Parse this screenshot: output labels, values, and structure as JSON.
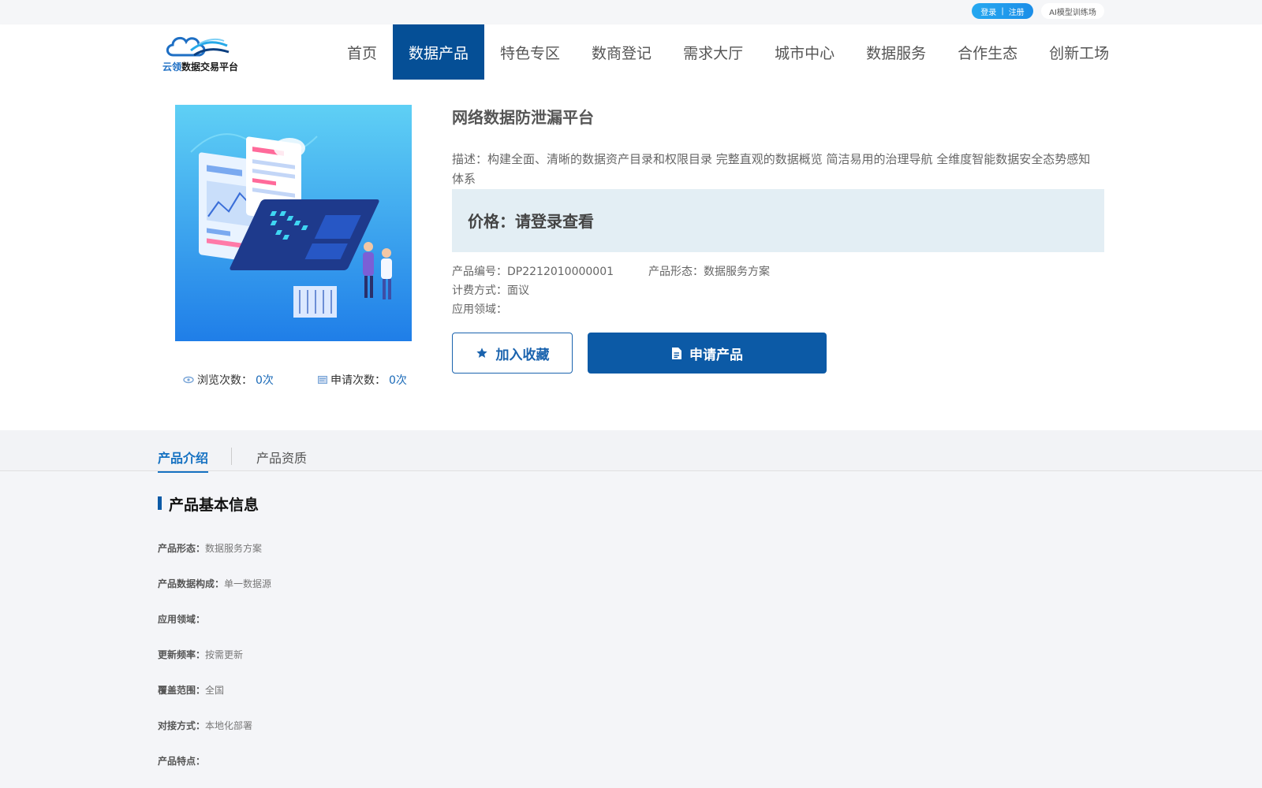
{
  "topbar": {
    "login": "登录",
    "separator": "|",
    "register": "注册",
    "ai_link": "AI模型训练场"
  },
  "brand": {
    "name_prefix": "云领",
    "name_suffix": "数据交易平台",
    "colors": {
      "primary": "#054f96",
      "accent": "#1672c2",
      "price_bg": "#e3eef4"
    }
  },
  "nav": [
    {
      "label": "首页",
      "active": false
    },
    {
      "label": "数据产品",
      "active": true
    },
    {
      "label": "特色专区",
      "active": false
    },
    {
      "label": "数商登记",
      "active": false
    },
    {
      "label": "需求大厅",
      "active": false
    },
    {
      "label": "城市中心",
      "active": false
    },
    {
      "label": "数据服务",
      "active": false
    },
    {
      "label": "合作生态",
      "active": false
    },
    {
      "label": "创新工场",
      "active": false
    }
  ],
  "product": {
    "title": "网络数据防泄漏平台",
    "description": "描述：构建全面、清晰的数据资产目录和权限目录 完整直观的数据概览 简洁易用的治理导航 全维度智能数据安全态势感知体系",
    "price": "价格：请登录查看",
    "code_label": "产品编号：",
    "code_value": "DP2212010000001",
    "form_label": "产品形态：",
    "form_value": "数据服务方案",
    "billing_label": "计费方式：",
    "billing_value": "面议",
    "domain_label": "应用领域：",
    "domain_value": "",
    "views_label": "浏览次数：",
    "views_value": "0次",
    "applies_label": "申请次数：",
    "applies_value": "0次",
    "fav_button": "加入收藏",
    "apply_button": "申请产品"
  },
  "tabs": [
    {
      "label": "产品介绍",
      "active": true
    },
    {
      "label": "产品资质",
      "active": false
    }
  ],
  "basic_info": {
    "title": "产品基本信息",
    "rows": [
      {
        "label": "产品形态：",
        "value": "数据服务方案"
      },
      {
        "label": "产品数据构成：",
        "value": "单一数据源"
      },
      {
        "label": "应用领域：",
        "value": ""
      },
      {
        "label": "更新频率：",
        "value": "按需更新"
      },
      {
        "label": "覆盖范围：",
        "value": "全国"
      },
      {
        "label": "对接方式：",
        "value": "本地化部署"
      },
      {
        "label": "产品特点：",
        "value": ""
      }
    ]
  }
}
